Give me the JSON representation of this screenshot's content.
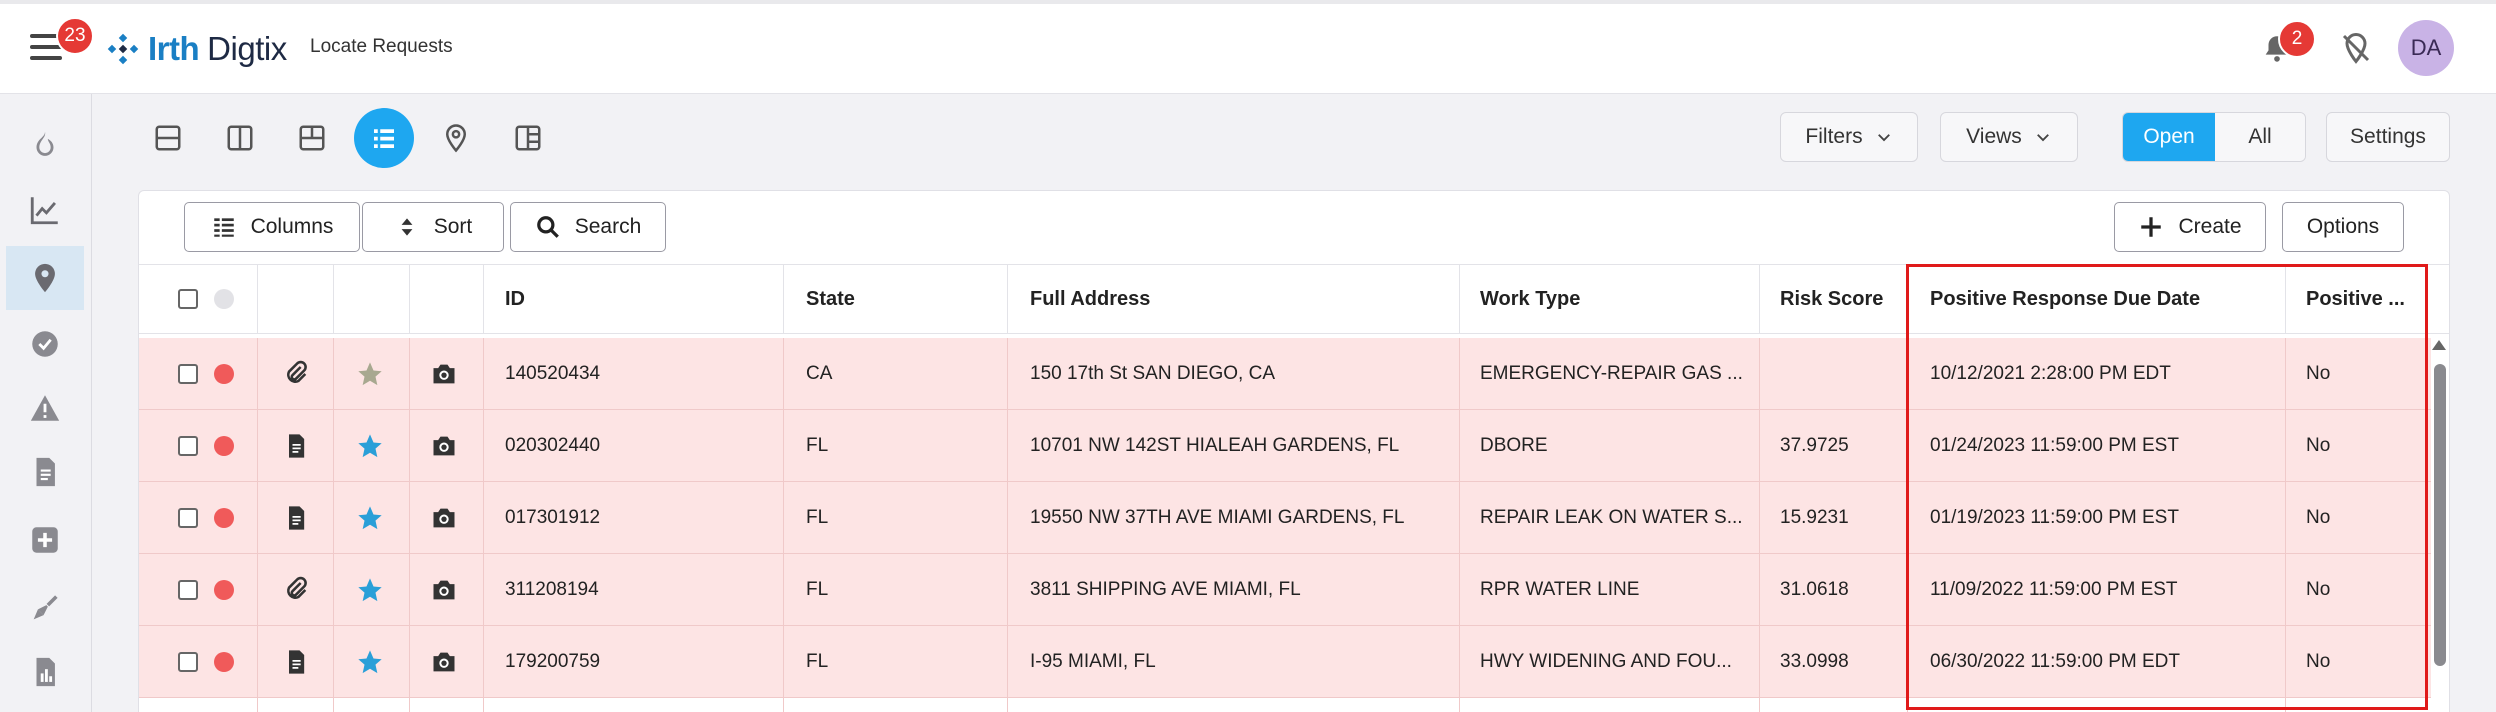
{
  "header": {
    "menu_badge": "23",
    "logo_part1": "Irth",
    "logo_part2": "Digtix",
    "page_label": "Locate Requests",
    "notification_badge": "2",
    "avatar_initials": "DA"
  },
  "sidebar": {
    "items": [
      {
        "icon": "flame-icon",
        "active": false
      },
      {
        "icon": "trend-chart-icon",
        "active": false
      },
      {
        "icon": "location-pin-icon",
        "active": true
      },
      {
        "icon": "check-circle-icon",
        "active": false
      },
      {
        "icon": "warning-icon",
        "active": false
      },
      {
        "icon": "document-icon",
        "active": false
      },
      {
        "icon": "plus-square-icon",
        "active": false
      },
      {
        "icon": "shovel-icon",
        "active": false
      },
      {
        "icon": "report-icon",
        "active": false
      }
    ]
  },
  "view_toolbar": {
    "filters_label": "Filters",
    "views_label": "Views",
    "open_label": "Open",
    "all_label": "All",
    "settings_label": "Settings"
  },
  "table_toolbar": {
    "columns_label": "Columns",
    "sort_label": "Sort",
    "search_label": "Search",
    "create_label": "Create",
    "options_label": "Options"
  },
  "table": {
    "headers": {
      "id": "ID",
      "state": "State",
      "address": "Full Address",
      "work_type": "Work Type",
      "risk_score": "Risk Score",
      "due_date": "Positive Response Due Date",
      "positive": "Positive ..."
    },
    "rows": [
      {
        "attach": "paperclip-icon",
        "star_color": "#a8a890",
        "id": "140520434",
        "state": "CA",
        "address": "150 17th St SAN DIEGO, CA",
        "work_type": "EMERGENCY-REPAIR GAS ...",
        "risk_score": "",
        "due_date": "10/12/2021 2:28:00 PM EDT",
        "positive": "No"
      },
      {
        "attach": "document-icon",
        "star_color": "#2a9fd8",
        "id": "020302440",
        "state": "FL",
        "address": "10701 NW 142ST HIALEAH GARDENS, FL",
        "work_type": "DBORE",
        "risk_score": "37.9725",
        "due_date": "01/24/2023 11:59:00 PM EST",
        "positive": "No"
      },
      {
        "attach": "document-icon",
        "star_color": "#2a9fd8",
        "id": "017301912",
        "state": "FL",
        "address": "19550 NW 37TH AVE MIAMI GARDENS, FL",
        "work_type": "REPAIR LEAK ON WATER S...",
        "risk_score": "15.9231",
        "due_date": "01/19/2023 11:59:00 PM EST",
        "positive": "No"
      },
      {
        "attach": "paperclip-icon",
        "star_color": "#2a9fd8",
        "id": "311208194",
        "state": "FL",
        "address": "3811 SHIPPING AVE MIAMI, FL",
        "work_type": "RPR WATER LINE",
        "risk_score": "31.0618",
        "due_date": "11/09/2022 11:59:00 PM EST",
        "positive": "No"
      },
      {
        "attach": "document-icon",
        "star_color": "#2a9fd8",
        "id": "179200759",
        "state": "FL",
        "address": "I-95 MIAMI, FL",
        "work_type": "HWY WIDENING AND FOU...",
        "risk_score": "33.0998",
        "due_date": "06/30/2022 11:59:00 PM EDT",
        "positive": "No"
      }
    ]
  },
  "colors": {
    "accent": "#1ea7f0",
    "row_highlight": "#fde4e4",
    "status_dot": "#f05a5a",
    "badge": "#e53935",
    "annotation_box": "#e01a1a"
  }
}
